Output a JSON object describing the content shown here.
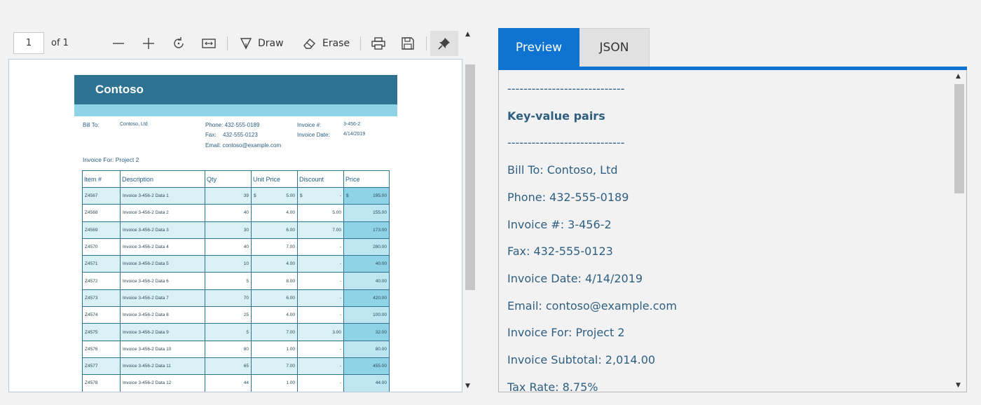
{
  "toolbar": {
    "page_number": "1",
    "page_of": "of 1",
    "draw_label": "Draw",
    "erase_label": "Erase"
  },
  "document": {
    "company": "Contoso",
    "bill_to_label": "Bill To:",
    "bill_to_value": "Contoso, Ltd",
    "phone": "Phone: 432-555-0189",
    "fax_label": "Fax:",
    "fax_value": "432-555-0123",
    "email": "Email: contoso@example.com",
    "invoice_no_label": "Invoice #:",
    "invoice_no_value": "3-456-2",
    "invoice_date_label": "Invoice Date:",
    "invoice_date_value": "4/14/2019",
    "invoice_for": "Invoice For: Project 2",
    "columns": [
      "Item #",
      "Description",
      "Qty",
      "Unit Price",
      "Discount",
      "Price"
    ],
    "rows": [
      {
        "item": "Z4567",
        "desc": "Invoice 3-456-2 Data 1",
        "qty": "39",
        "unit_cur": "$",
        "unit": "5.00",
        "disc_cur": "$",
        "disc": "-",
        "price_cur": "$",
        "price": "195.00"
      },
      {
        "item": "Z4568",
        "desc": "Invoice 3-456-2 Data 2",
        "qty": "40",
        "unit_cur": "",
        "unit": "4.00",
        "disc_cur": "",
        "disc": "5.00",
        "price_cur": "",
        "price": "155.00"
      },
      {
        "item": "Z4569",
        "desc": "Invoice 3-456-2 Data 3",
        "qty": "30",
        "unit_cur": "",
        "unit": "6.00",
        "disc_cur": "",
        "disc": "7.00",
        "price_cur": "",
        "price": "173.00"
      },
      {
        "item": "Z4570",
        "desc": "Invoice 3-456-2 Data 4",
        "qty": "40",
        "unit_cur": "",
        "unit": "7.00",
        "disc_cur": "",
        "disc": "-",
        "price_cur": "",
        "price": "280.00"
      },
      {
        "item": "Z4571",
        "desc": "Invoice 3-456-2 Data 5",
        "qty": "10",
        "unit_cur": "",
        "unit": "4.00",
        "disc_cur": "",
        "disc": "-",
        "price_cur": "",
        "price": "40.00"
      },
      {
        "item": "Z4572",
        "desc": "Invoice 3-456-2 Data 6",
        "qty": "5",
        "unit_cur": "",
        "unit": "8.00",
        "disc_cur": "",
        "disc": "-",
        "price_cur": "",
        "price": "40.00"
      },
      {
        "item": "Z4573",
        "desc": "Invoice 3-456-2 Data 7",
        "qty": "70",
        "unit_cur": "",
        "unit": "6.00",
        "disc_cur": "",
        "disc": "-",
        "price_cur": "",
        "price": "420.00"
      },
      {
        "item": "Z4574",
        "desc": "Invoice 3-456-2 Data 8",
        "qty": "25",
        "unit_cur": "",
        "unit": "4.00",
        "disc_cur": "",
        "disc": "-",
        "price_cur": "",
        "price": "100.00"
      },
      {
        "item": "Z4575",
        "desc": "Invoice 3-456-2 Data 9",
        "qty": "5",
        "unit_cur": "",
        "unit": "7.00",
        "disc_cur": "",
        "disc": "3.00",
        "price_cur": "",
        "price": "32.00"
      },
      {
        "item": "Z4576",
        "desc": "Invoice 3-456-2 Data 10",
        "qty": "80",
        "unit_cur": "",
        "unit": "1.00",
        "disc_cur": "",
        "disc": "-",
        "price_cur": "",
        "price": "80.00"
      },
      {
        "item": "Z4577",
        "desc": "Invoice 3-456-2 Data 11",
        "qty": "65",
        "unit_cur": "",
        "unit": "7.00",
        "disc_cur": "",
        "disc": "-",
        "price_cur": "",
        "price": "455.00"
      },
      {
        "item": "Z4578",
        "desc": "Invoice 3-456-2 Data 12",
        "qty": "44",
        "unit_cur": "",
        "unit": "1.00",
        "disc_cur": "",
        "disc": "-",
        "price_cur": "",
        "price": "44.00"
      }
    ]
  },
  "tabs": {
    "preview": "Preview",
    "json": "JSON"
  },
  "panel": {
    "lines": [
      {
        "text": "-----------------------------",
        "bold": false
      },
      {
        "text": "Key-value pairs",
        "bold": true
      },
      {
        "text": "-----------------------------",
        "bold": false
      },
      {
        "text": "Bill To: Contoso, Ltd",
        "bold": false
      },
      {
        "text": "Phone: 432-555-0189",
        "bold": false
      },
      {
        "text": "Invoice #: 3-456-2",
        "bold": false
      },
      {
        "text": "Fax: 432-555-0123",
        "bold": false
      },
      {
        "text": "Invoice Date: 4/14/2019",
        "bold": false
      },
      {
        "text": "Email: contoso@example.com",
        "bold": false
      },
      {
        "text": "Invoice For: Project 2",
        "bold": false
      },
      {
        "text": "Invoice Subtotal: 2,014.00",
        "bold": false
      },
      {
        "text": "Tax Rate: 8.75%",
        "bold": false
      }
    ]
  },
  "colors": {
    "accent": "#0f74d1",
    "banner": "#2e7391",
    "banner_light": "#8fd3e6"
  }
}
